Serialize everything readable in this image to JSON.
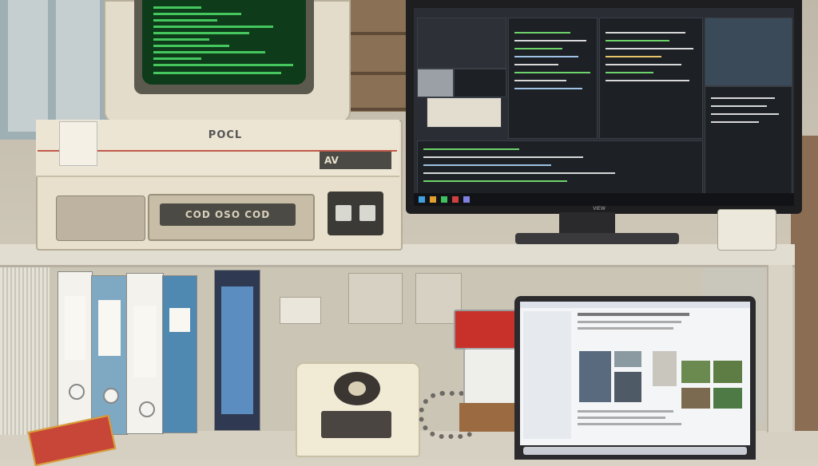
{
  "crt_unit": {
    "logo_text": "POCL",
    "plate_text": "AV",
    "drive_slot_text": "COD OSO COD"
  },
  "monitor": {
    "brand_text": "VIEW"
  },
  "colors": {
    "crt_text": "#4fe06b",
    "unit_beige": "#e8e0cc",
    "monitor_bezel": "#1e1e20",
    "ide_background": "#2a2d33",
    "phone_red_device": "#c8312a"
  }
}
